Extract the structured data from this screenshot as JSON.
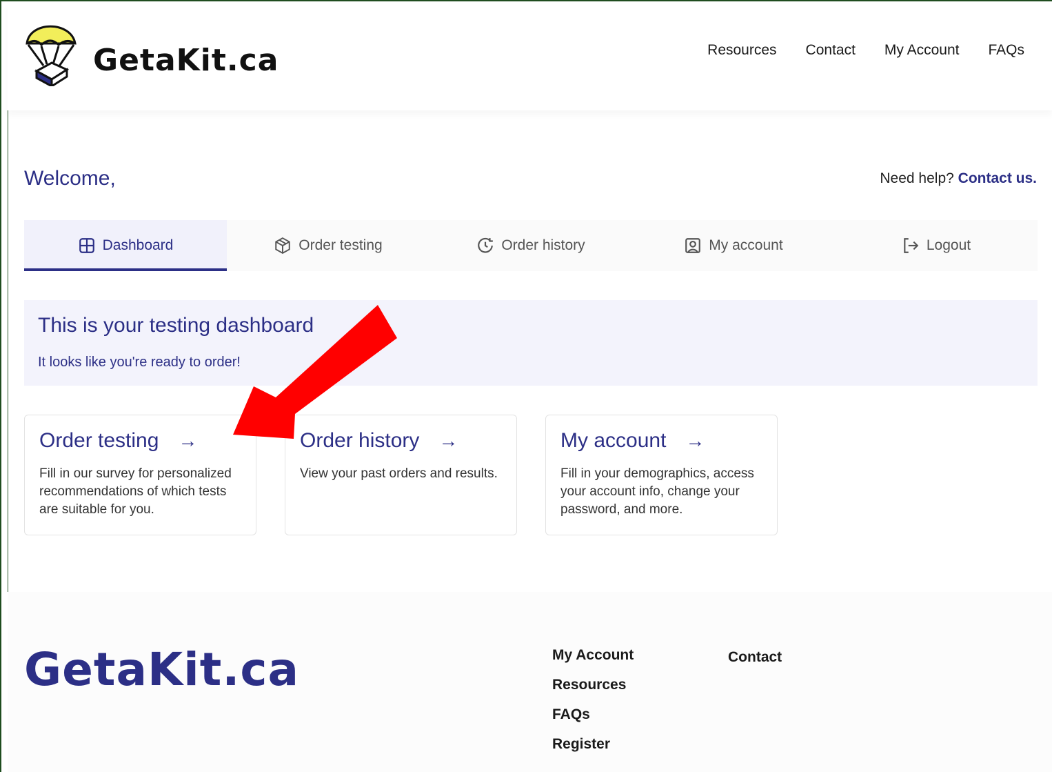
{
  "brand": {
    "name": "GetaKit.ca"
  },
  "nav": {
    "items": [
      {
        "label": "Resources"
      },
      {
        "label": "Contact"
      },
      {
        "label": "My Account"
      },
      {
        "label": "FAQs"
      }
    ]
  },
  "welcome": {
    "greeting": "Welcome,"
  },
  "help": {
    "prefix": "Need help?",
    "link": "Contact us."
  },
  "tabs": [
    {
      "label": "Dashboard",
      "icon": "grid-icon"
    },
    {
      "label": "Order testing",
      "icon": "box-icon"
    },
    {
      "label": "Order history",
      "icon": "clock-icon"
    },
    {
      "label": "My account",
      "icon": "user-icon"
    },
    {
      "label": "Logout",
      "icon": "logout-icon"
    }
  ],
  "banner": {
    "title": "This is your testing dashboard",
    "subtitle": "It looks like you're ready to order!"
  },
  "cards": [
    {
      "title": "Order testing",
      "arrow": "→",
      "description": "Fill in our survey for personalized recommendations of which tests are suitable for you."
    },
    {
      "title": "Order history",
      "arrow": "→",
      "description": "View your past orders and results."
    },
    {
      "title": "My account",
      "arrow": "→",
      "description": "Fill in your demographics, access your account info, change your password, and more."
    }
  ],
  "footer": {
    "logo": "GetaKit.ca",
    "col1": [
      {
        "label": "My Account"
      },
      {
        "label": "Resources"
      },
      {
        "label": "FAQs"
      },
      {
        "label": "Register"
      }
    ],
    "col2": [
      {
        "label": "Contact"
      }
    ]
  },
  "colors": {
    "accent": "#2c2f86",
    "annotation_arrow": "#ff0000",
    "parachute": "#f2ee5a"
  }
}
